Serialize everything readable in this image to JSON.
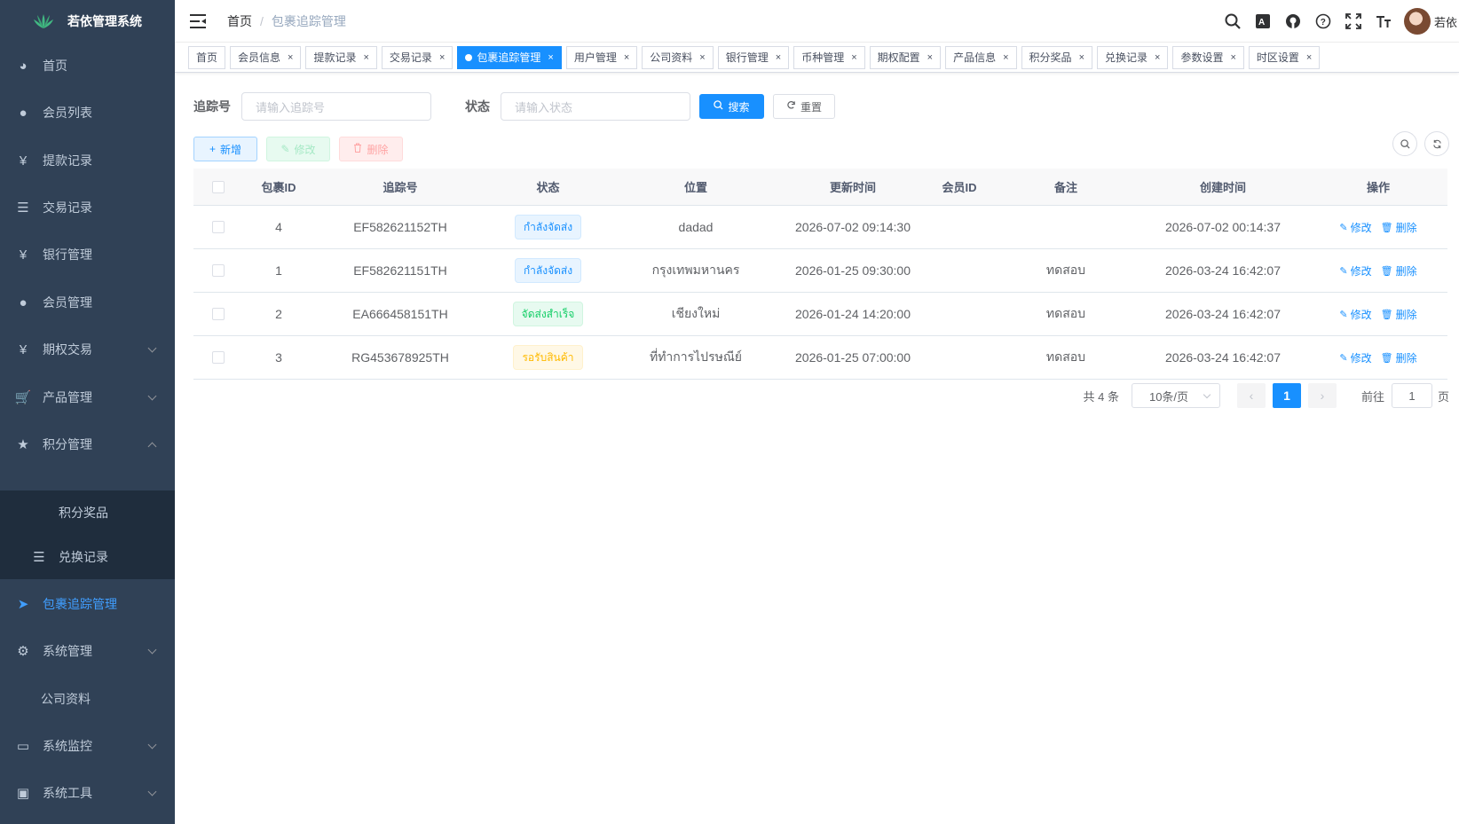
{
  "app": {
    "title": "若依管理系统"
  },
  "sidebar": {
    "items": [
      {
        "label": "首页",
        "icon": "dashboard-icon"
      },
      {
        "label": "会员列表",
        "icon": "user-icon"
      },
      {
        "label": "提款记录",
        "icon": "yen-icon"
      },
      {
        "label": "交易记录",
        "icon": "list-icon"
      },
      {
        "label": "银行管理",
        "icon": "yen-icon"
      },
      {
        "label": "会员管理",
        "icon": "users-icon"
      },
      {
        "label": "期权交易",
        "icon": "yen-icon"
      },
      {
        "label": "产品管理",
        "icon": "cart-icon"
      },
      {
        "label": "积分管理",
        "icon": "star-icon"
      },
      {
        "label": "积分奖品",
        "icon": ""
      },
      {
        "label": "兑换记录",
        "icon": "list-icon"
      },
      {
        "label": "包裹追踪管理",
        "icon": "send-icon"
      },
      {
        "label": "系统管理",
        "icon": "gear-icon"
      },
      {
        "label": "公司资料",
        "icon": ""
      },
      {
        "label": "系统监控",
        "icon": "monitor-icon"
      },
      {
        "label": "系统工具",
        "icon": "toolbox-icon"
      }
    ]
  },
  "navbar": {
    "breadcrumb": {
      "home": "首页",
      "sep": "/",
      "current": "包裹追踪管理"
    },
    "user": "若依"
  },
  "tags": [
    {
      "label": "首页",
      "closable": false,
      "active": false
    },
    {
      "label": "会员信息",
      "closable": true,
      "active": false
    },
    {
      "label": "提款记录",
      "closable": true,
      "active": false
    },
    {
      "label": "交易记录",
      "closable": true,
      "active": false
    },
    {
      "label": "包裹追踪管理",
      "closable": true,
      "active": true
    },
    {
      "label": "用户管理",
      "closable": true,
      "active": false
    },
    {
      "label": "公司资料",
      "closable": true,
      "active": false
    },
    {
      "label": "银行管理",
      "closable": true,
      "active": false
    },
    {
      "label": "币种管理",
      "closable": true,
      "active": false
    },
    {
      "label": "期权配置",
      "closable": true,
      "active": false
    },
    {
      "label": "产品信息",
      "closable": true,
      "active": false
    },
    {
      "label": "积分奖品",
      "closable": true,
      "active": false
    },
    {
      "label": "兑换记录",
      "closable": true,
      "active": false
    },
    {
      "label": "参数设置",
      "closable": true,
      "active": false
    },
    {
      "label": "时区设置",
      "closable": true,
      "active": false
    }
  ],
  "tag_close_symbol": "×",
  "search": {
    "tracking_label": "追踪号",
    "tracking_placeholder": "请输入追踪号",
    "status_label": "状态",
    "status_placeholder": "请输入状态",
    "search_btn": "搜索",
    "reset_btn": "重置"
  },
  "toolbar": {
    "add": "新增",
    "edit": "修改",
    "delete": "删除"
  },
  "table": {
    "headers": [
      "包裹ID",
      "追踪号",
      "状态",
      "位置",
      "更新时间",
      "会员ID",
      "备注",
      "创建时间",
      "操作"
    ],
    "rows": [
      {
        "id": "4",
        "tracking": "EF582621152TH",
        "status": "กำลังจัดส่ง",
        "status_type": "blue",
        "location": "dadad",
        "updated": "2026-07-02 09:14:30",
        "member": "",
        "remark": "",
        "created": "2026-07-02 00:14:37"
      },
      {
        "id": "1",
        "tracking": "EF582621151TH",
        "status": "กำลังจัดส่ง",
        "status_type": "blue",
        "location": "กรุงเทพมหานคร",
        "updated": "2026-01-25 09:30:00",
        "member": "",
        "remark": "ทดสอบ",
        "created": "2026-03-24 16:42:07"
      },
      {
        "id": "2",
        "tracking": "EA666458151TH",
        "status": "จัดส่งสำเร็จ",
        "status_type": "green",
        "location": "เชียงใหม่",
        "updated": "2026-01-24 14:20:00",
        "member": "",
        "remark": "ทดสอบ",
        "created": "2026-03-24 16:42:07"
      },
      {
        "id": "3",
        "tracking": "RG453678925TH",
        "status": "รอรับสินค้า",
        "status_type": "yellow",
        "location": "ที่ทำการไปรษณีย์",
        "updated": "2026-01-25 07:00:00",
        "member": "",
        "remark": "ทดสอบ",
        "created": "2026-03-24 16:42:07"
      }
    ],
    "op_edit": "修改",
    "op_delete": "删除"
  },
  "pagination": {
    "total": "共 4 条",
    "page_size": "10条/页",
    "current": "1",
    "goto_label": "前往",
    "goto_value": "1",
    "page_suffix": "页"
  },
  "colors": {
    "sidebar_bg": "#304156",
    "primary": "#1890ff"
  }
}
